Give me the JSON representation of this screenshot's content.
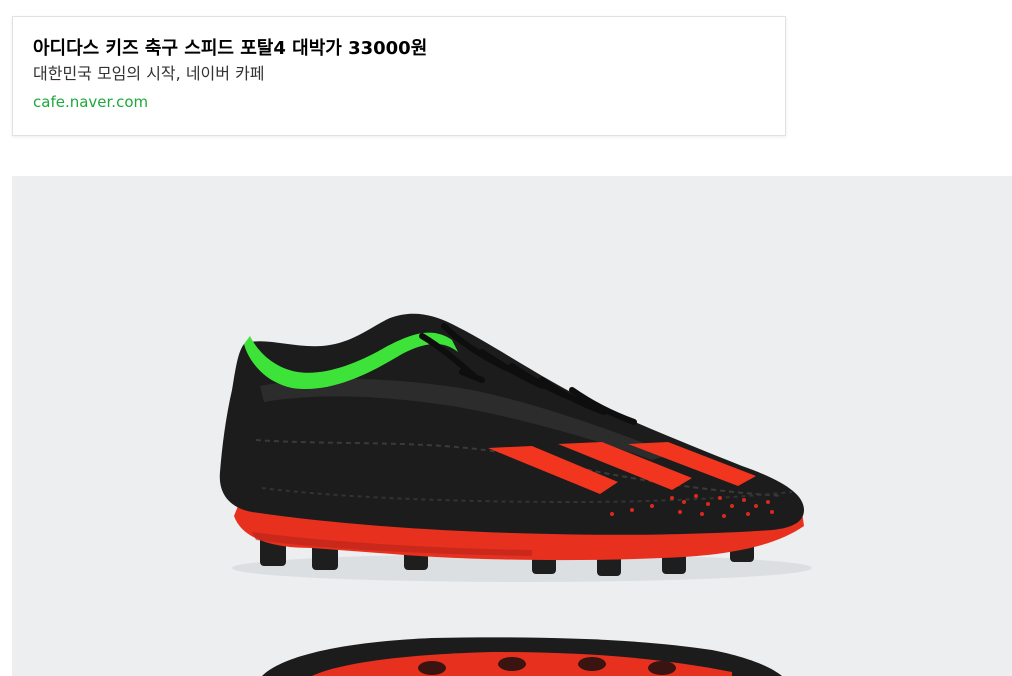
{
  "link_preview": {
    "title": "아디다스 키즈 축구 스피드 포탈4 대박가 33000원",
    "description": "대한민국 모임의 시작, 네이버 카페",
    "url": "cafe.naver.com"
  },
  "product_image": {
    "subject": "soccer-cleat",
    "colors": {
      "background": "#eceeef",
      "shoe_body": "#1c1c1c",
      "collar_accent": "#3ee33a",
      "stripes": "#f2351f",
      "soleplate": "#e8301f"
    }
  }
}
